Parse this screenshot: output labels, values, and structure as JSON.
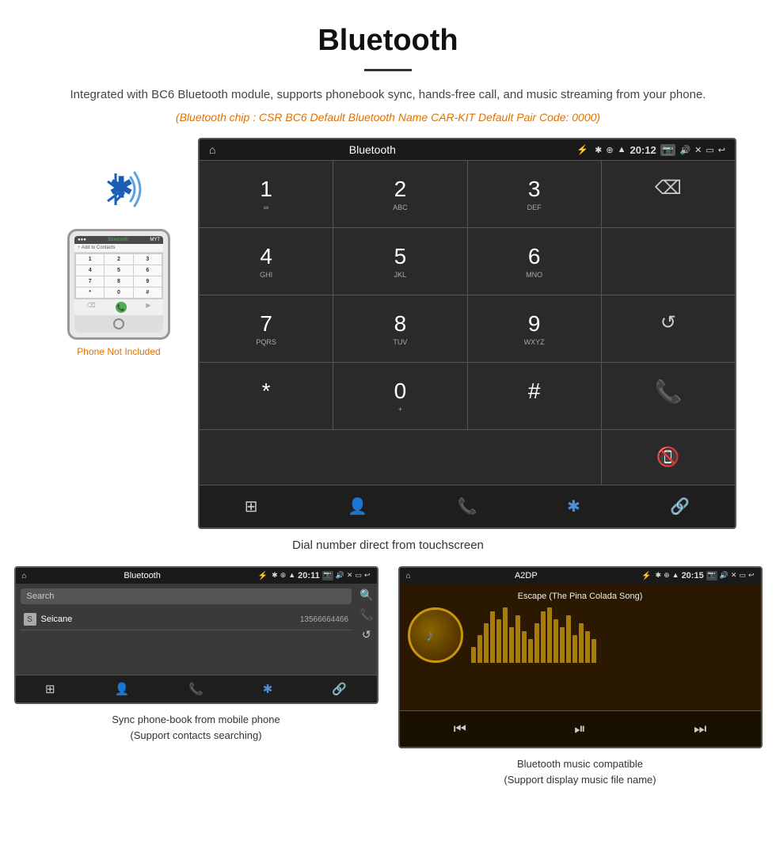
{
  "page": {
    "title": "Bluetooth",
    "subtitle": "Integrated with BC6 Bluetooth module, supports phonebook sync, hands-free call, and music streaming from your phone.",
    "tech_specs": "(Bluetooth chip : CSR BC6    Default Bluetooth Name CAR-KIT    Default Pair Code: 0000)",
    "main_caption": "Dial number direct from touchscreen",
    "bottom_left_caption_line1": "Sync phone-book from mobile phone",
    "bottom_left_caption_line2": "(Support contacts searching)",
    "bottom_right_caption_line1": "Bluetooth music compatible",
    "bottom_right_caption_line2": "(Support display music file name)",
    "phone_not_included": "Phone Not Included"
  },
  "large_screen": {
    "status_bar": {
      "screen_title": "Bluetooth",
      "time": "20:12",
      "charge_icon": "⚡",
      "usb_icon": "⚓"
    },
    "dialpad": [
      {
        "num": "1",
        "sub": "∞",
        "type": "normal"
      },
      {
        "num": "2",
        "sub": "ABC",
        "type": "normal"
      },
      {
        "num": "3",
        "sub": "DEF",
        "type": "normal"
      },
      {
        "num": "",
        "sub": "",
        "type": "backspace"
      },
      {
        "num": "4",
        "sub": "GHI",
        "type": "normal"
      },
      {
        "num": "5",
        "sub": "JKL",
        "type": "normal"
      },
      {
        "num": "6",
        "sub": "MNO",
        "type": "normal"
      },
      {
        "num": "",
        "sub": "",
        "type": "empty"
      },
      {
        "num": "7",
        "sub": "PQRS",
        "type": "normal"
      },
      {
        "num": "8",
        "sub": "TUV",
        "type": "normal"
      },
      {
        "num": "9",
        "sub": "WXYZ",
        "type": "normal"
      },
      {
        "num": "",
        "sub": "",
        "type": "refresh"
      },
      {
        "num": "*",
        "sub": "",
        "type": "normal"
      },
      {
        "num": "0",
        "sub": "+",
        "type": "normal"
      },
      {
        "num": "#",
        "sub": "",
        "type": "normal"
      },
      {
        "num": "",
        "sub": "",
        "type": "call-green"
      },
      {
        "num": "",
        "sub": "",
        "type": "call-red"
      }
    ],
    "bottom_nav_icons": [
      "⊞",
      "👤",
      "📞",
      "✱",
      "🔗"
    ]
  },
  "phonebook_screen": {
    "status_bar": {
      "title": "Bluetooth",
      "time": "20:11"
    },
    "search_placeholder": "Search",
    "contacts": [
      {
        "letter": "S",
        "name": "Seicane",
        "number": "13566664466"
      }
    ]
  },
  "music_screen": {
    "status_bar": {
      "title": "A2DP",
      "time": "20:15"
    },
    "song_title": "Escape (The Pina Colada Song)",
    "eq_bars": [
      20,
      35,
      50,
      65,
      55,
      70,
      45,
      60,
      40,
      30,
      50,
      65,
      70,
      55,
      45,
      60,
      35,
      50,
      40,
      30
    ]
  }
}
